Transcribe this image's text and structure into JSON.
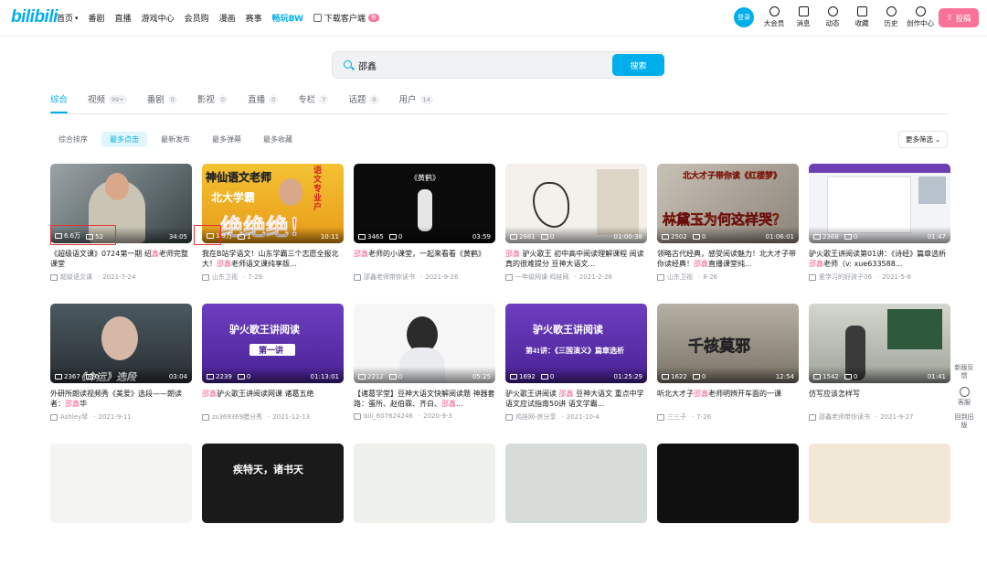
{
  "logo": "bilibili",
  "nav": {
    "left": [
      "首页",
      "番剧",
      "直播",
      "游戏中心",
      "会员购",
      "漫画",
      "赛事"
    ],
    "highlight": "畅玩BW",
    "download": "下载客户端",
    "download_badge": "新",
    "login": "登录",
    "right": [
      "大会员",
      "消息",
      "动态",
      "收藏",
      "历史",
      "创作中心"
    ],
    "upload": "投稿"
  },
  "search": {
    "value": "邵鑫",
    "button": "搜索"
  },
  "tabs": [
    {
      "label": "综合",
      "count": ""
    },
    {
      "label": "视频",
      "count": "99+"
    },
    {
      "label": "番剧",
      "count": "0"
    },
    {
      "label": "影视",
      "count": "0"
    },
    {
      "label": "直播",
      "count": "0"
    },
    {
      "label": "专栏",
      "count": "7"
    },
    {
      "label": "话题",
      "count": "0"
    },
    {
      "label": "用户",
      "count": "14"
    }
  ],
  "filters": [
    "综合排序",
    "最多点击",
    "最新发布",
    "最多弹幕",
    "最多收藏"
  ],
  "filter_more": "更多筛选",
  "keyword_color": "#f25d8e",
  "accent": "#00aeec",
  "videos": [
    {
      "views": "6.6万",
      "danmaku": "52",
      "duration": "34:05",
      "title_pre": "《超级语文课》0724第一期 绍",
      "title_kw": "鑫",
      "title_post": "老师完整课堂",
      "up": "超级语文课",
      "date": "2021-7-24"
    },
    {
      "views": "1.9万",
      "danmaku": "1",
      "duration": "10:11",
      "title_pre": "我在B站学语文！山东学霸三个志愿全报北大！",
      "title_kw": "邵鑫",
      "title_post": "老师语文课纯享版...",
      "up": "山东卫视",
      "date": "7-29"
    },
    {
      "views": "3465",
      "danmaku": "0",
      "duration": "03:59",
      "title_pre": "",
      "title_kw": "邵鑫",
      "title_post": "老师的小课堂，一起来看看《黄鹤》",
      "up": "邵鑫老师带你读书",
      "date": "2021-9-26"
    },
    {
      "views": "2881",
      "danmaku": "0",
      "duration": "01:00:38",
      "title_pre": "",
      "title_kw": "邵鑫",
      "title_post": " 驴火歌王 初中高中阅读理解课程 阅读真的很难提分 豆神大语文...",
      "up": "一年级网课-鸡娃网",
      "date": "2021-2-26"
    },
    {
      "views": "2502",
      "danmaku": "0",
      "duration": "01:06:01",
      "title_pre": "领略古代经典，感受阅读魅力！北大才子带你读经典！",
      "title_kw": "邵鑫",
      "title_post": "直播课堂纯...",
      "up": "山东卫视",
      "date": "8-26"
    },
    {
      "views": "2368",
      "danmaku": "0",
      "duration": "01:47",
      "title_pre": "驴火歌王讲阅读第01讲：《诗经》篇章选析",
      "title_kw": "邵鑫",
      "title_post": "老师（v: xue633588...",
      "up": "爱学习的好孩子06",
      "date": "2021-5-6"
    },
    {
      "views": "2367",
      "danmaku": "0",
      "duration": "03:04",
      "title_pre": "外研所朗读视频秀《美爱》选段——朗读者：",
      "title_kw": "邵鑫",
      "title_post": "华",
      "up": "Ashley琴",
      "date": "2021-9-11"
    },
    {
      "views": "2239",
      "danmaku": "0",
      "duration": "01:13:01",
      "title_pre": "",
      "title_kw": "邵鑫",
      "title_post": "驴火歌王讲阅读网课 诸葛五绝",
      "up": "zs369369腊分秀",
      "date": "2021-12-13"
    },
    {
      "views": "2212",
      "danmaku": "0",
      "duration": "05:25",
      "title_pre": "【诸葛学堂】豆神大语文快解阅读题 神器套路：蛋所、赵伯霖、齐白、",
      "title_kw": "邵鑫",
      "title_post": "...",
      "up": "bili_607624246",
      "date": "2020-9-3"
    },
    {
      "views": "1692",
      "danmaku": "0",
      "duration": "01:25:29",
      "title_pre": "驴火歌王讲阅读 ",
      "title_kw": "邵鑫",
      "title_post": " 豆神大语文 重点中学语文应试指南50讲 语文学霸...",
      "up": "鸡娃网-房分享",
      "date": "2021-10-4"
    },
    {
      "views": "1622",
      "danmaku": "0",
      "duration": "12:54",
      "title_pre": "听北大才子",
      "title_kw": "邵鑫",
      "title_post": "老师明辨开车面的一课",
      "up": "三三子",
      "date": "7-26"
    },
    {
      "views": "1542",
      "danmaku": "0",
      "duration": "01:41",
      "title_pre": "仿写应该怎样写",
      "title_kw": "",
      "title_post": "",
      "up": "邵鑫老师带你读书",
      "date": "2021-9-27"
    }
  ],
  "thumb_text": {
    "t2_top": "神仙语文老师",
    "t2_tag": "语文专业户",
    "t2_mid": "北大学霸",
    "t2_big": "绝绝绝！",
    "t3": "《黄鹤》",
    "t5_top": "北大才子带你读《红楼梦》",
    "t5_big": "林黛玉为何这样哭？",
    "t8": "驴火歌王讲阅读",
    "t8_sub": "第一讲",
    "t10": "驴火歌王讲阅读",
    "t10_sub": "第41讲：《三国演义》篇章选析",
    "t11": "千核莫邪",
    "t7": "《命运》选段",
    "r3_4": "疾特天，诸书天"
  },
  "side": [
    "新版反馈",
    "客服",
    "回到旧版"
  ]
}
